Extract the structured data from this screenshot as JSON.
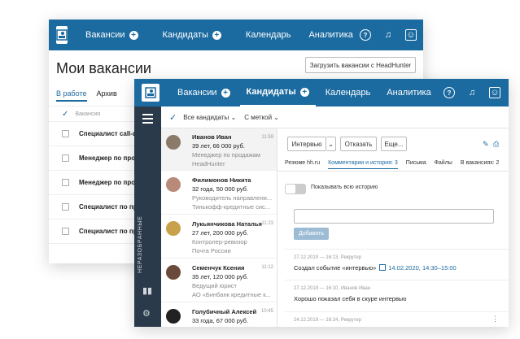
{
  "window_back": {
    "nav": [
      {
        "label": "Вакансии",
        "plus": true
      },
      {
        "label": "Кандидаты",
        "plus": true
      },
      {
        "label": "Календарь",
        "plus": false
      },
      {
        "label": "Аналитика",
        "plus": false
      }
    ],
    "title": "Мои вакансии",
    "hh_button": "Загрузить вакансии с HeadHunter",
    "tabs": [
      "В работе",
      "Архив"
    ],
    "column_header": "Вакансия",
    "vacancies": [
      "Специалист call-ц",
      "Менеджер по про",
      "Менеджер по про",
      "Специалист по пр",
      "Специалист по пр"
    ]
  },
  "window_front": {
    "nav": [
      {
        "label": "Вакансии",
        "plus": true,
        "active": false
      },
      {
        "label": "Кандидаты",
        "plus": true,
        "active": true
      },
      {
        "label": "Календарь",
        "plus": false,
        "active": false
      },
      {
        "label": "Аналитика",
        "plus": false,
        "active": false
      }
    ],
    "sidebar_label": "НЕРАЗОБРАННЫЕ",
    "filters": {
      "all": "Все кандидаты ⌄",
      "tag": "С меткой ⌄"
    },
    "candidates": [
      {
        "name": "Иванов Иван",
        "info": "39 лет, 66 000 руб.",
        "sub1": "Менеджер по продажам",
        "sub2": "HeadHunter",
        "time": "11:59",
        "avatar": "#8a7a6a"
      },
      {
        "name": "Филимонов Никита",
        "info": "32 года, 50 000 руб.",
        "sub1": "Руководитель направлени...",
        "sub2": "Тинькофф-кредитные сис...",
        "time": "",
        "avatar": "#b98a7a"
      },
      {
        "name": "Лукьянчикова Наталья",
        "info": "27 лет, 200 000 руб.",
        "sub1": "Контролер-ревизор",
        "sub2": "Почта России",
        "time": "11:23",
        "avatar": "#c8a24a"
      },
      {
        "name": "Семенчук Ксения",
        "info": "35 лет, 120 000 руб.",
        "sub1": "Ведущий юрист",
        "sub2": "АО «Бинбанк кредитные к...",
        "time": "11:12",
        "avatar": "#6a4a3a"
      },
      {
        "name": "Голубичный Алексей",
        "info": "33 года, 67 000 руб.",
        "sub1": "",
        "sub2": "",
        "time": "10:45",
        "avatar": "#222222"
      }
    ],
    "detail": {
      "stage": "Интервью",
      "stage_caret": "⌄",
      "reject": "Отказать",
      "more": "Еще...",
      "tabs": [
        "Резюме hh.ru",
        "Комментарии и история: 3",
        "Письма",
        "Файлы",
        "В вакансиях: 2"
      ],
      "toggle_label": "Показывать всю историю",
      "add_button": "Добавить",
      "history": [
        {
          "meta": "27.12.2019 — 16:13, Рекрутер",
          "text": "Создал событие «интервью»",
          "link": "14.02.2020, 14:30–15:00"
        },
        {
          "meta": "27.12.2019 — 16:10, Иванов Иван",
          "text": "Хорошо показал себя в скуре интервью",
          "link": ""
        },
        {
          "meta": "24.12.2019 — 16:24, Рекрутер",
          "text": "",
          "link": ""
        }
      ]
    }
  },
  "colors": {
    "brand": "#1b6aa0",
    "sidebar": "#2b3a4a"
  }
}
